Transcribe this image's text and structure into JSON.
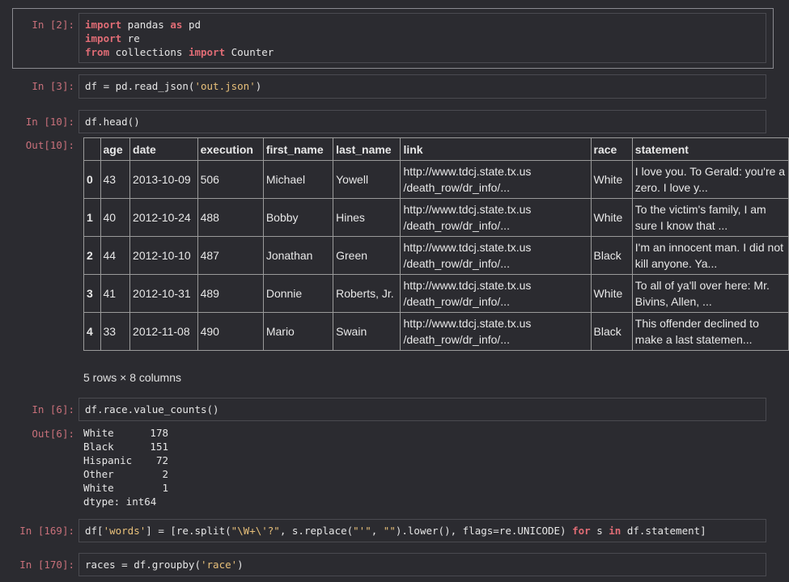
{
  "cells": [
    {
      "prompt": "In [2]:",
      "lines": [
        [
          {
            "t": "import",
            "c": "kw"
          },
          {
            "t": " pandas ",
            "c": "plain"
          },
          {
            "t": "as",
            "c": "kw"
          },
          {
            "t": " pd",
            "c": "plain"
          }
        ],
        [
          {
            "t": "import",
            "c": "kw"
          },
          {
            "t": " re",
            "c": "plain"
          }
        ],
        [
          {
            "t": "from",
            "c": "kw"
          },
          {
            "t": " collections ",
            "c": "plain"
          },
          {
            "t": "import",
            "c": "kw"
          },
          {
            "t": " Counter",
            "c": "plain"
          }
        ]
      ]
    },
    {
      "prompt": "In [3]:",
      "lines": [
        [
          {
            "t": "df = pd.read_json(",
            "c": "plain"
          },
          {
            "t": "'out.json'",
            "c": "str"
          },
          {
            "t": ")",
            "c": "plain"
          }
        ]
      ]
    },
    {
      "prompt": "In [10]:",
      "lines": [
        [
          {
            "t": "df.head()",
            "c": "plain"
          }
        ]
      ]
    },
    {
      "prompt": "In [6]:",
      "lines": [
        [
          {
            "t": "df.race.value_counts()",
            "c": "plain"
          }
        ]
      ]
    },
    {
      "prompt": "In [169]:",
      "lines": [
        [
          {
            "t": "df[",
            "c": "plain"
          },
          {
            "t": "'words'",
            "c": "str"
          },
          {
            "t": "] = [re.split(",
            "c": "plain"
          },
          {
            "t": "\"\\W+\\'?\"",
            "c": "str"
          },
          {
            "t": ", s.replace(",
            "c": "plain"
          },
          {
            "t": "\"'\"",
            "c": "str"
          },
          {
            "t": ", ",
            "c": "plain"
          },
          {
            "t": "\"\"",
            "c": "str"
          },
          {
            "t": ").lower(), flags=re.UNICODE) ",
            "c": "plain"
          },
          {
            "t": "for",
            "c": "kw"
          },
          {
            "t": " s ",
            "c": "plain"
          },
          {
            "t": "in",
            "c": "kw"
          },
          {
            "t": " df.statement]",
            "c": "plain"
          }
        ]
      ]
    },
    {
      "prompt": "In [170]:",
      "lines": [
        [
          {
            "t": "races = df.groupby(",
            "c": "plain"
          },
          {
            "t": "'race'",
            "c": "str"
          },
          {
            "t": ")",
            "c": "plain"
          }
        ]
      ]
    }
  ],
  "outputs": {
    "head_prompt": "Out[10]:",
    "vc_prompt": "Out[6]:"
  },
  "dataframe": {
    "columns": [
      "",
      "age",
      "date",
      "execution",
      "first_name",
      "last_name",
      "link",
      "race",
      "statement"
    ],
    "rows": [
      [
        "0",
        "43",
        "2013-10-09",
        "506",
        "Michael",
        "Yowell",
        "http://www.tdcj.state.tx.us /death_row/dr_info/...",
        "White",
        "I love you. To Gerald: you're a zero. I love y..."
      ],
      [
        "1",
        "40",
        "2012-10-24",
        "488",
        "Bobby",
        "Hines",
        "http://www.tdcj.state.tx.us /death_row/dr_info/...",
        "White",
        "To the victim's family, I am sure I know that ..."
      ],
      [
        "2",
        "44",
        "2012-10-10",
        "487",
        "Jonathan",
        "Green",
        "http://www.tdcj.state.tx.us /death_row/dr_info/...",
        "Black",
        "I'm an innocent man. I did not kill anyone. Ya..."
      ],
      [
        "3",
        "41",
        "2012-10-31",
        "489",
        "Donnie",
        "Roberts, Jr.",
        "http://www.tdcj.state.tx.us /death_row/dr_info/...",
        "White",
        "To all of ya'll over here: Mr. Bivins, Allen, ..."
      ],
      [
        "4",
        "33",
        "2012-11-08",
        "490",
        "Mario",
        "Swain",
        "http://www.tdcj.state.tx.us /death_row/dr_info/...",
        "Black",
        "This offender declined to make a last statemen..."
      ]
    ],
    "shape_note": "5 rows × 8 columns"
  },
  "value_counts": {
    "rows": [
      {
        "label": "White",
        "value": "178"
      },
      {
        "label": "Black",
        "value": "151"
      },
      {
        "label": "Hispanic",
        "value": "72"
      },
      {
        "label": "Other",
        "value": "2"
      },
      {
        "label": "White ",
        "value": "1"
      }
    ],
    "dtype": "dtype: int64"
  }
}
